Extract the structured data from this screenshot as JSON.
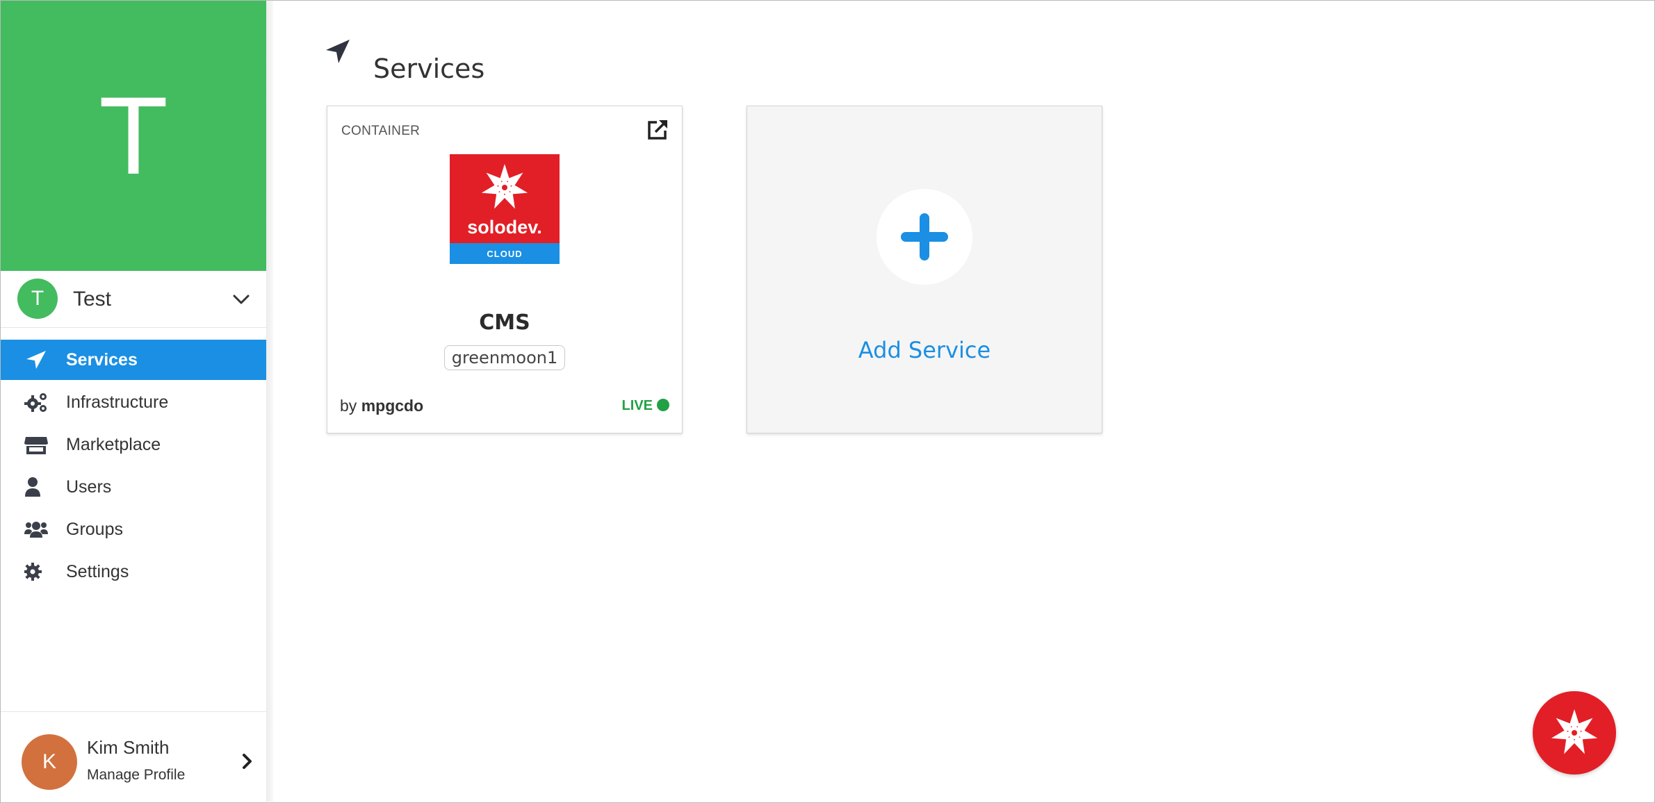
{
  "org": {
    "banner_letter": "T",
    "avatar_letter": "T",
    "name": "Test",
    "banner_color": "#43bb5f"
  },
  "nav": {
    "items": [
      {
        "label": "Services",
        "icon": "location-arrow-icon",
        "active": true
      },
      {
        "label": "Infrastructure",
        "icon": "cogs-icon",
        "active": false
      },
      {
        "label": "Marketplace",
        "icon": "store-icon",
        "active": false
      },
      {
        "label": "Users",
        "icon": "user-icon",
        "active": false
      },
      {
        "label": "Groups",
        "icon": "users-icon",
        "active": false
      },
      {
        "label": "Settings",
        "icon": "gear-icon",
        "active": false
      }
    ],
    "active_color": "#1a8fe3"
  },
  "profile": {
    "avatar_letter": "K",
    "name": "Kim Smith",
    "subtitle": "Manage Profile",
    "avatar_color": "#d2713e"
  },
  "page": {
    "title": "Services",
    "icon": "location-arrow-icon"
  },
  "services": [
    {
      "type": "CONTAINER",
      "logo_word": "solodev.",
      "logo_sub": "CLOUD",
      "name": "CMS",
      "tag": "greenmoon1",
      "by_prefix": "by",
      "owner": "mpgcdo",
      "status": "LIVE",
      "status_color": "#22a045"
    }
  ],
  "add_service": {
    "label": "Add Service"
  },
  "fab": {
    "icon": "solodev-logo-icon",
    "color": "#e21f26"
  }
}
